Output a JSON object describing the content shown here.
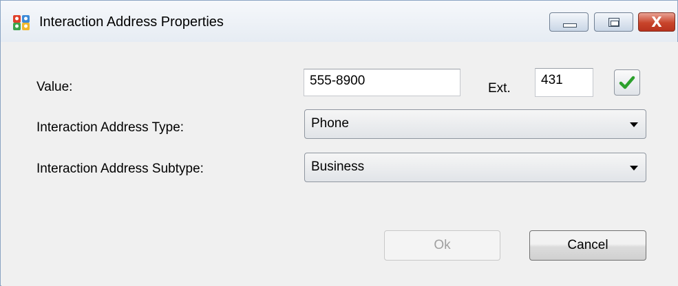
{
  "window": {
    "title": "Interaction Address Properties",
    "app_icon": "address-book-icon",
    "controls": {
      "minimize_icon": "minimize-icon",
      "maximize_icon": "maximize-icon",
      "close_icon": "close-icon",
      "close_glyph": "X"
    }
  },
  "form": {
    "value": {
      "label": "Value:",
      "current": "555-8900",
      "ext_label": "Ext.",
      "ext_value": "431",
      "validate_icon": "checkmark-icon",
      "validate_color": "#2ca02c"
    },
    "type": {
      "label": "Interaction Address Type:",
      "selected": "Phone"
    },
    "subtype": {
      "label": "Interaction Address Subtype:",
      "selected": "Business"
    }
  },
  "buttons": {
    "ok_label": "Ok",
    "ok_enabled": false,
    "cancel_label": "Cancel"
  },
  "colors": {
    "close_button": "#c8442b",
    "window_background": "#f0f0f0"
  }
}
